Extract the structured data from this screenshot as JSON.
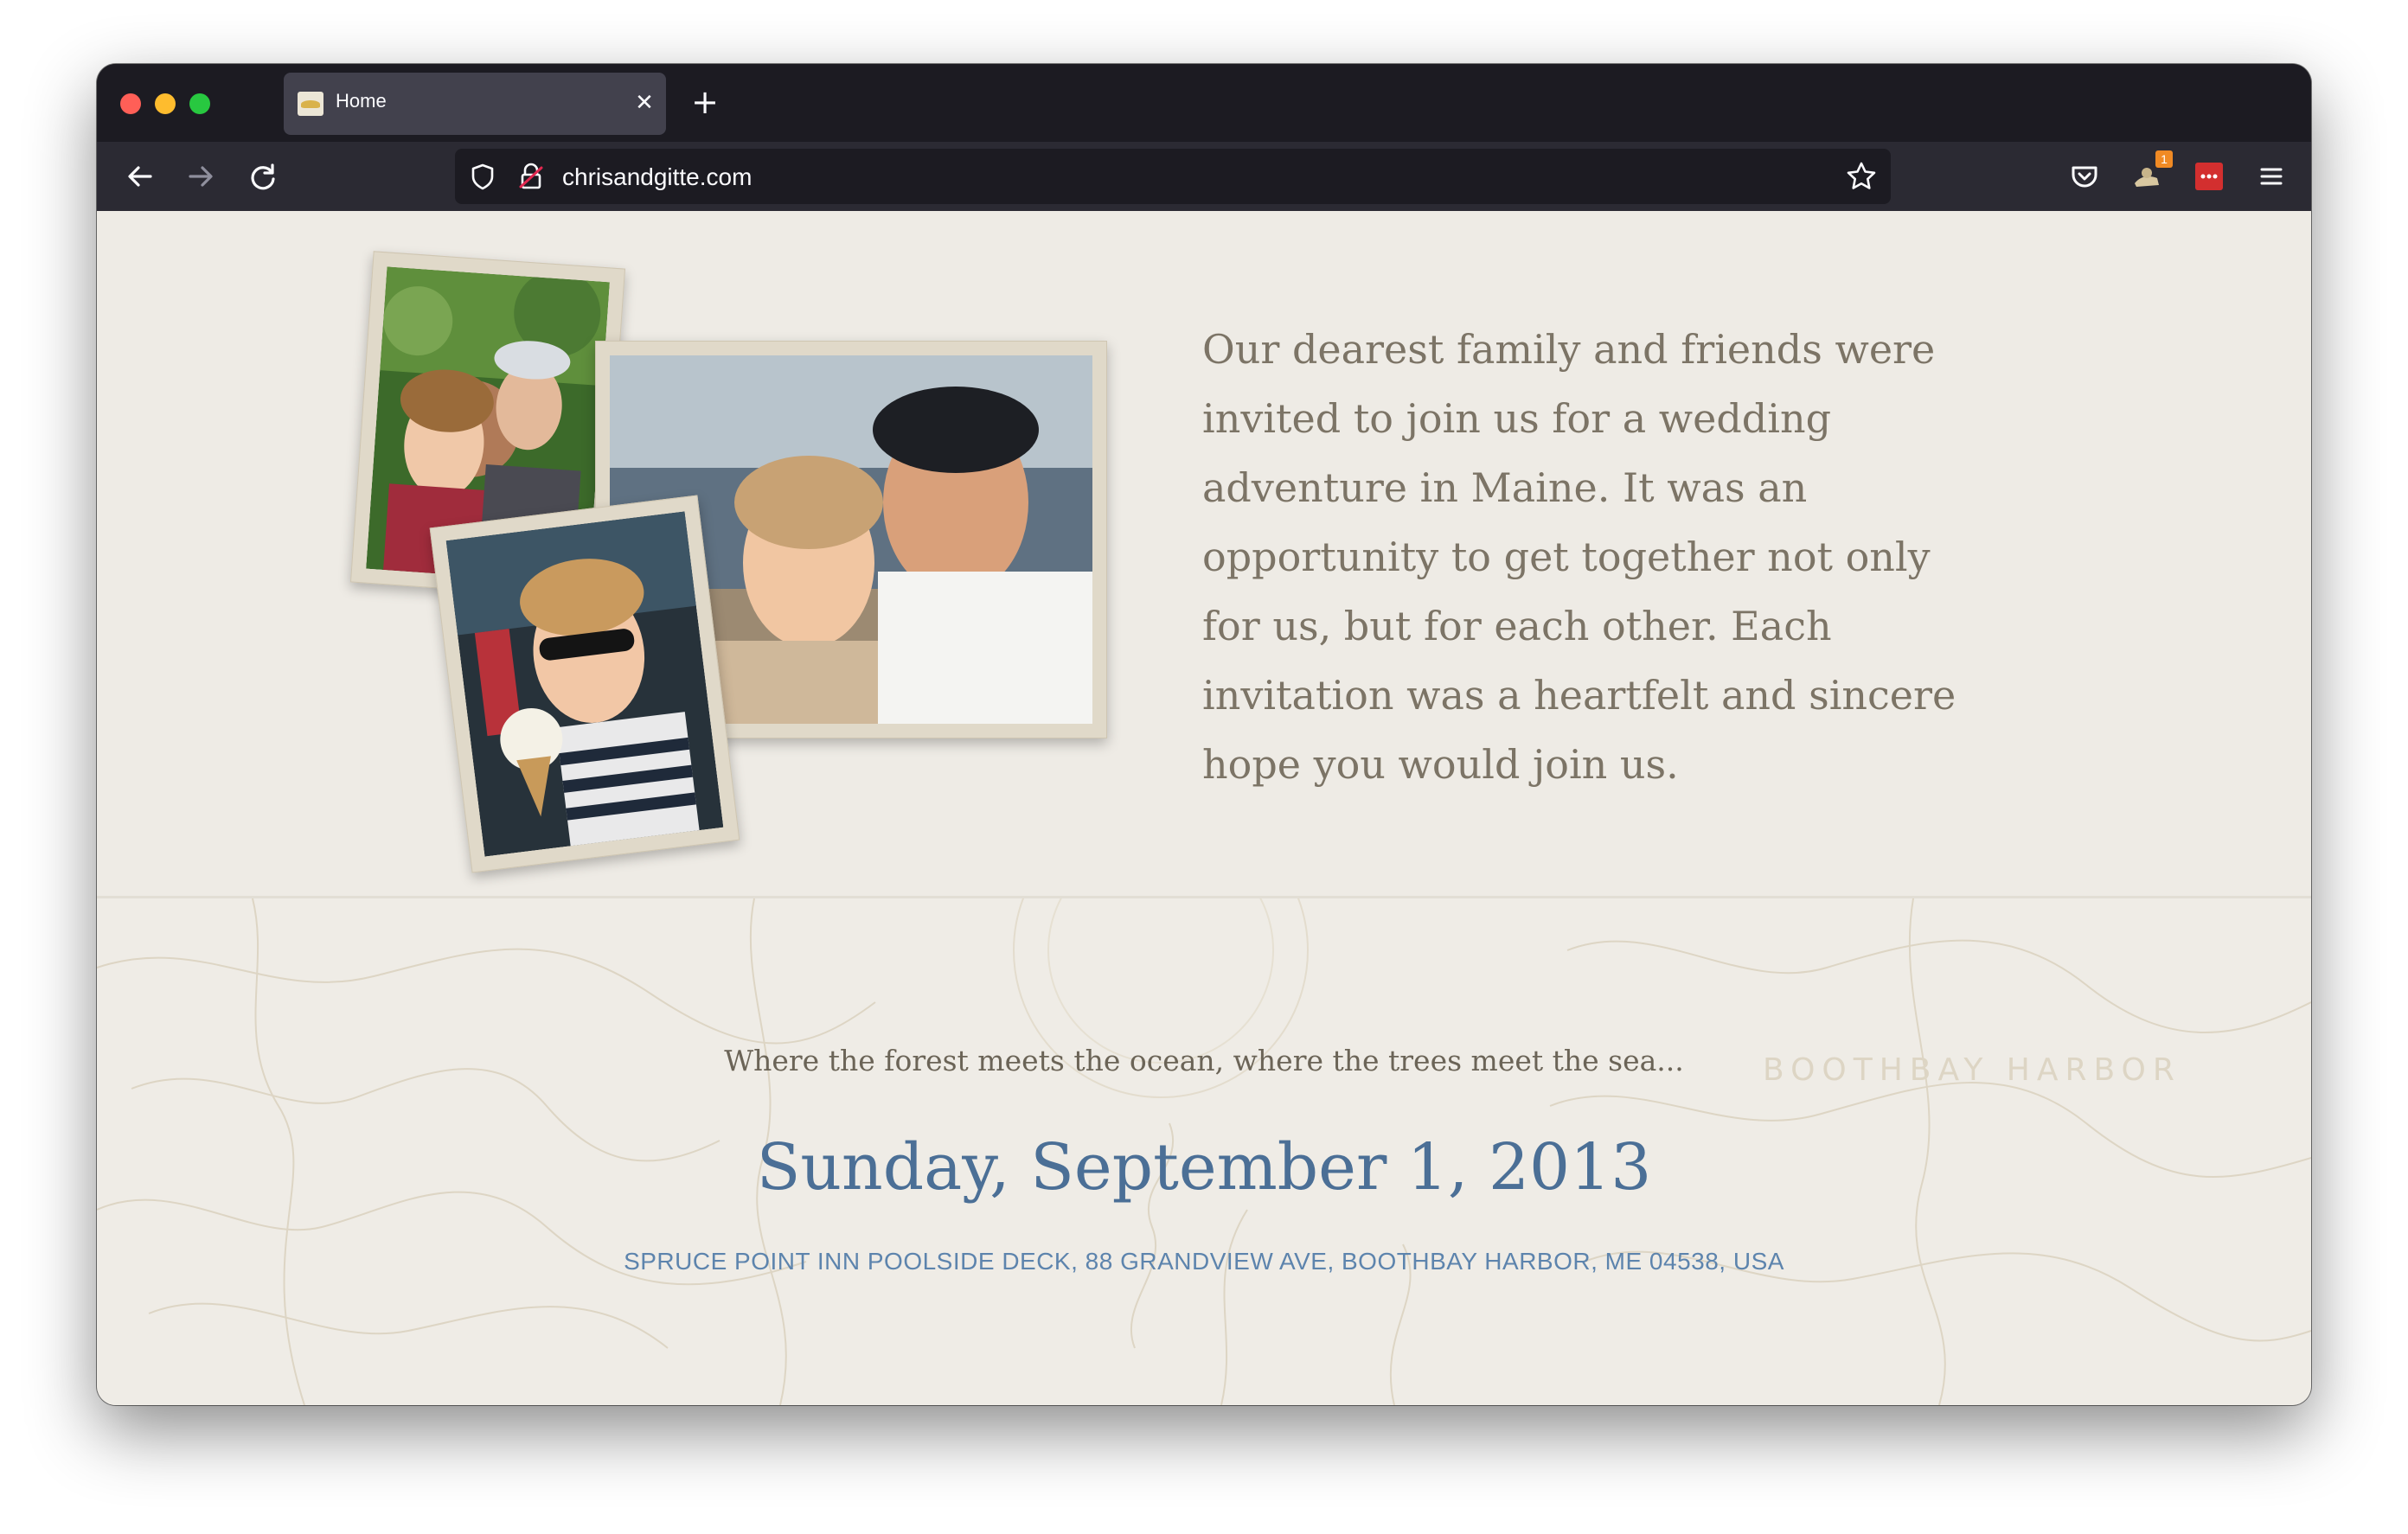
{
  "browser": {
    "tab": {
      "title": "Home",
      "favicon": "boat-favicon"
    },
    "url": "chrisandgitte.com",
    "extension_badge": "1"
  },
  "page": {
    "intro": "Our dearest family and friends were invited to join us for a wedding adventure in Maine. It was an opportunity to get together not only for us, but for each other. Each invitation was a heartfelt and sincere hope you would join us.",
    "tagline": "Where the forest meets the ocean, where the trees meet the sea...",
    "date": "Sunday, September 1, 2013",
    "venue": "SPRUCE POINT INN POOLSIDE DECK, 88 GRANDVIEW AVE, BOOTHBAY HARBOR, ME 04538, USA",
    "map_label": "BOOTHBAY HARBOR"
  },
  "colors": {
    "page_bg": "#eeebe5",
    "date_blue": "#4b6f96",
    "venue_blue": "#5d84ad",
    "body_text": "#7c7466"
  }
}
